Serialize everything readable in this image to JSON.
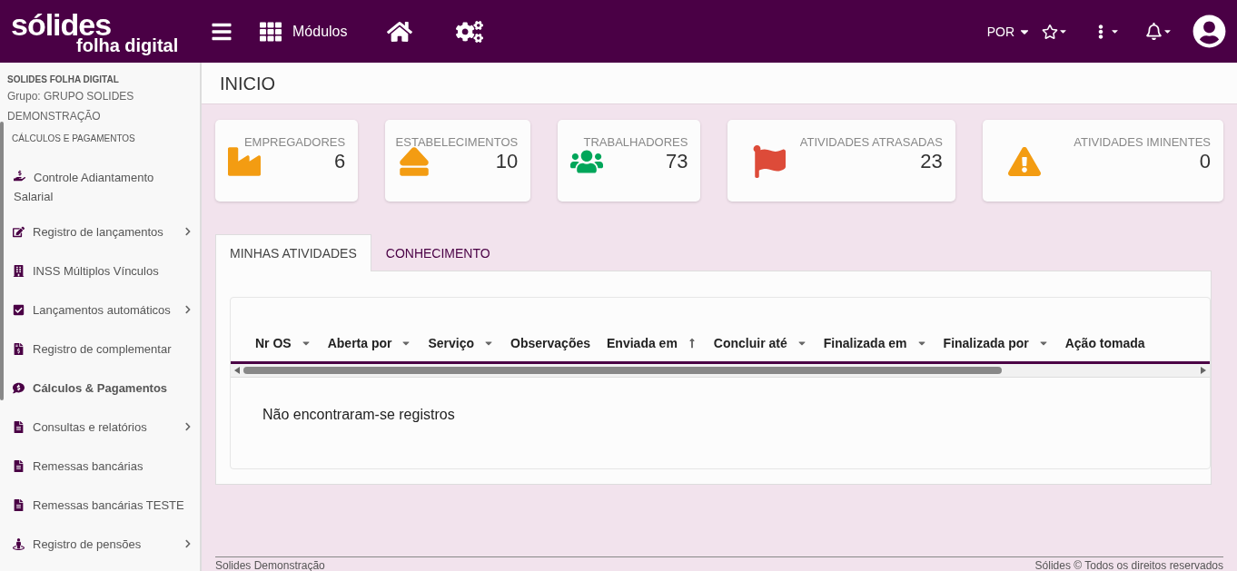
{
  "header": {
    "logo": "sólides",
    "logo_sub": "folha digital",
    "modules": "Módulos",
    "language": "POR"
  },
  "sidebar": {
    "company": "SOLIDES FOLHA DIGITAL",
    "group": "Grupo: GRUPO SOLIDES DEMONSTRAÇÃO",
    "section": "CÁLCULOS E PAGAMENTOS",
    "items": [
      {
        "label": "Controle Adiantamento Salarial",
        "kind": "hand-money",
        "expandable": false,
        "selected": false
      },
      {
        "label": "Registro de lançamentos",
        "kind": "edit",
        "expandable": true,
        "selected": false
      },
      {
        "label": "INSS Múltiplos Vínculos",
        "kind": "buildings",
        "expandable": false,
        "selected": false
      },
      {
        "label": "Lançamentos automáticos",
        "kind": "check",
        "expandable": true,
        "selected": false
      },
      {
        "label": "Registro de complementar",
        "kind": "invoice",
        "expandable": false,
        "selected": false
      },
      {
        "label": "Cálculos & Pagamentos",
        "kind": "money",
        "expandable": false,
        "selected": true
      },
      {
        "label": "Consultas e relatórios",
        "kind": "file",
        "expandable": true,
        "selected": false
      },
      {
        "label": "Remessas bancárias",
        "kind": "file",
        "expandable": false,
        "selected": false
      },
      {
        "label": "Remessas bancárias TESTE",
        "kind": "file",
        "expandable": false,
        "selected": false
      },
      {
        "label": "Registro de pensões",
        "kind": "person",
        "expandable": true,
        "selected": false
      }
    ]
  },
  "page_title": "INICIO",
  "stats": [
    {
      "label": "EMPREGADORES",
      "value": "6",
      "kind": "factory",
      "color": "#f39c12"
    },
    {
      "label": "ESTABELECIMENTOS",
      "value": "10",
      "kind": "eject",
      "color": "#f39c12"
    },
    {
      "label": "TRABALHADORES",
      "value": "73",
      "kind": "users",
      "color": "#00a65a"
    },
    {
      "label": "ATIVIDADES ATRASADAS",
      "value": "23",
      "kind": "flag",
      "color": "#dd4b39"
    },
    {
      "label": "ATIVIDADES IMINENTES",
      "value": "0",
      "kind": "warning",
      "color": "#f39c12"
    }
  ],
  "tabs": [
    {
      "label": "MINHAS ATIVIDADES",
      "selected": true
    },
    {
      "label": "CONHECIMENTO",
      "selected": false
    }
  ],
  "table": {
    "columns": [
      {
        "label": "Nr OS",
        "has_menu": true,
        "sorted_ascending": false
      },
      {
        "label": "Aberta por",
        "has_menu": true,
        "sorted_ascending": false
      },
      {
        "label": "Serviço",
        "has_menu": true,
        "sorted_ascending": false
      },
      {
        "label": "Observações",
        "has_menu": false,
        "sorted_ascending": false
      },
      {
        "label": "Enviada em",
        "has_menu": false,
        "sorted_ascending": true
      },
      {
        "label": "Concluir até",
        "has_menu": true,
        "sorted_ascending": false
      },
      {
        "label": "Finalizada em",
        "has_menu": true,
        "sorted_ascending": false
      },
      {
        "label": "Finalizada por",
        "has_menu": true,
        "sorted_ascending": false
      },
      {
        "label": "Ação tomada",
        "has_menu": false,
        "sorted_ascending": false
      }
    ],
    "empty": "Não encontraram-se registros"
  },
  "footer": {
    "left": "Solides Demonstração",
    "right": "Sólides © Todos os direitos reservados"
  }
}
